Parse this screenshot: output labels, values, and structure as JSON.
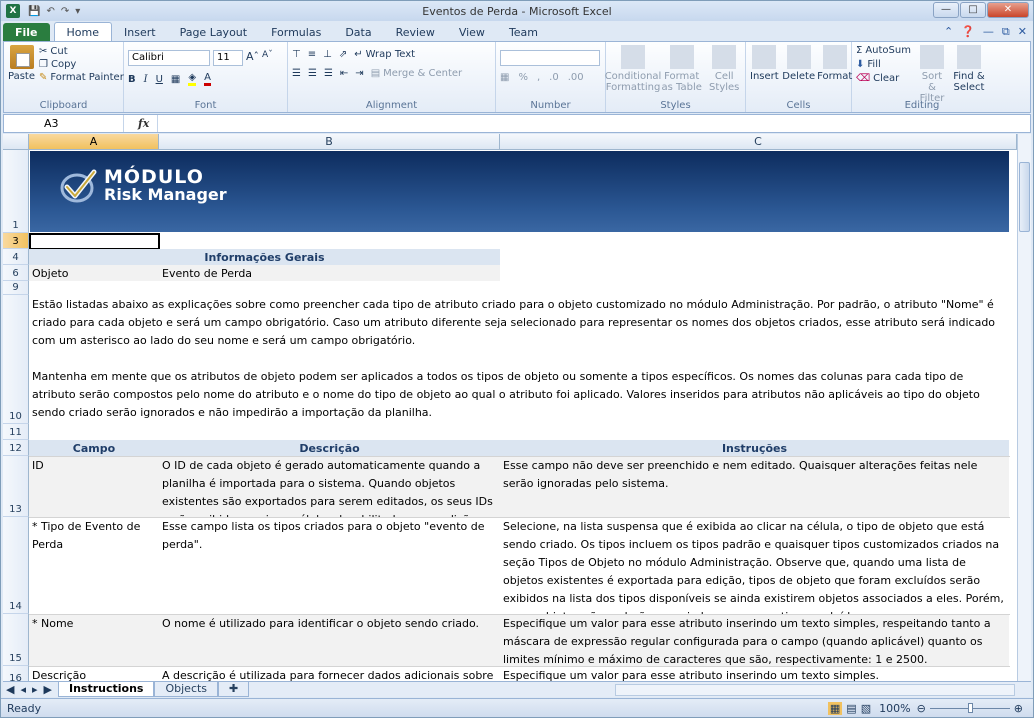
{
  "window": {
    "title": "Eventos de Perda - Microsoft Excel",
    "app_icon": "X"
  },
  "tabs": [
    {
      "label": "File"
    },
    {
      "label": "Home"
    },
    {
      "label": "Insert"
    },
    {
      "label": "Page Layout"
    },
    {
      "label": "Formulas"
    },
    {
      "label": "Data"
    },
    {
      "label": "Review"
    },
    {
      "label": "View"
    },
    {
      "label": "Team"
    }
  ],
  "ribbon": {
    "clipboard": {
      "paste": "Paste",
      "cut": "Cut",
      "copy": "Copy",
      "format_painter": "Format Painter",
      "label": "Clipboard"
    },
    "font": {
      "name": "Calibri",
      "size": "11",
      "bold": "B",
      "italic": "I",
      "underline": "U",
      "label": "Font"
    },
    "alignment": {
      "wrap_text": "Wrap Text",
      "merge_center": "Merge & Center",
      "label": "Alignment"
    },
    "number": {
      "percent": "%",
      "comma": ",",
      "label": "Number"
    },
    "styles": {
      "conditional": "Conditional Formatting",
      "format_table": "Format as Table",
      "cell_styles": "Cell Styles",
      "label": "Styles"
    },
    "cells": {
      "insert": "Insert",
      "delete": "Delete",
      "format": "Format",
      "label": "Cells"
    },
    "editing": {
      "autosum": "AutoSum",
      "fill": "Fill",
      "clear": "Clear",
      "sort_filter": "Sort & Filter",
      "find_select": "Find & Select",
      "label": "Editing"
    }
  },
  "formula_bar": {
    "name_box": "A3",
    "fx": "fx",
    "value": ""
  },
  "columns": [
    {
      "label": "A"
    },
    {
      "label": "B"
    },
    {
      "label": "C"
    }
  ],
  "rows": [
    {
      "n": "1"
    },
    {
      "n": "3"
    },
    {
      "n": "4"
    },
    {
      "n": "6"
    },
    {
      "n": "9"
    },
    {
      "n": "10"
    },
    {
      "n": "11"
    },
    {
      "n": "12"
    },
    {
      "n": "13"
    },
    {
      "n": "14"
    },
    {
      "n": "15"
    },
    {
      "n": "16"
    }
  ],
  "logo": {
    "line1": "MÓDULO",
    "line2": "Risk Manager"
  },
  "info": {
    "header": "Informações Gerais",
    "label": "Objeto",
    "value": "Evento de Perda"
  },
  "paragraphs": {
    "p1": "Estão listadas abaixo as explicações sobre como preencher cada tipo de atributo criado para o objeto customizado no módulo Administração. Por padrão, o atributo \"Nome\" é criado para cada objeto e será um campo obrigatório. Caso um atributo diferente seja selecionado para representar os nomes dos objetos criados, esse atributo será indicado com um asterisco ao lado do seu nome e será um campo obrigatório.",
    "p2": "Mantenha em mente que os atributos de objeto podem ser aplicados a todos os tipos de objeto ou somente a tipos específicos. Os nomes das colunas para cada tipo de atributo serão compostos pelo nome do atributo e o nome do tipo de objeto ao qual o atributo foi aplicado. Valores inseridos para atributos não aplicáveis ao tipo do objeto sendo criado serão ignorados e não impedirão a importação da planilha."
  },
  "table": {
    "headers": [
      "Campo",
      "Descrição",
      "Instruções"
    ],
    "rows": [
      {
        "campo": "ID",
        "descricao": "O ID de cada objeto é gerado automaticamente quando a planilha é importada para o sistema. Quando objetos existentes são exportados para serem editados, os seus IDs serão exibidos aqui em células desabilitadas para edição.",
        "instrucoes": "Esse campo não deve ser preenchido e nem editado. Quaisquer alterações feitas nele serão ignoradas pelo sistema."
      },
      {
        "campo": "* Tipo de Evento de Perda",
        "descricao": "Esse campo lista os tipos criados para o objeto \"evento de perda\".",
        "instrucoes": "Selecione, na lista suspensa que é exibida ao clicar na célula, o tipo de objeto que está sendo criado. Os tipos incluem os tipos padrão e quaisquer tipos customizados criados na seção Tipos de Objeto no módulo Administração. Observe que, quando uma lista de objetos existentes é exportada para edição, tipos de objeto que foram excluídos serão exibidos na lista dos tipos disponíveis se ainda existirem objetos associados a eles. Porém, novos objetos não poderão ser criados com esses tipos excluídos."
      },
      {
        "campo": "* Nome",
        "descricao": "O nome é utilizado para identificar o objeto sendo criado.",
        "instrucoes": "Especifique um valor para esse atributo inserindo um texto simples, respeitando tanto a máscara de expressão regular configurada para o campo (quando aplicável) quanto os limites mínimo e máximo de caracteres que são, respectivamente: 1 e 2500."
      },
      {
        "campo": "Descrição",
        "descricao": "A descrição é utilizada para fornecer dados adicionais sobre o",
        "instrucoes": "Especifique um valor para esse atributo inserindo um texto simples."
      }
    ]
  },
  "sheets": [
    {
      "label": "Instructions"
    },
    {
      "label": "Objects"
    }
  ],
  "status": {
    "ready": "Ready",
    "zoom": "100%"
  }
}
